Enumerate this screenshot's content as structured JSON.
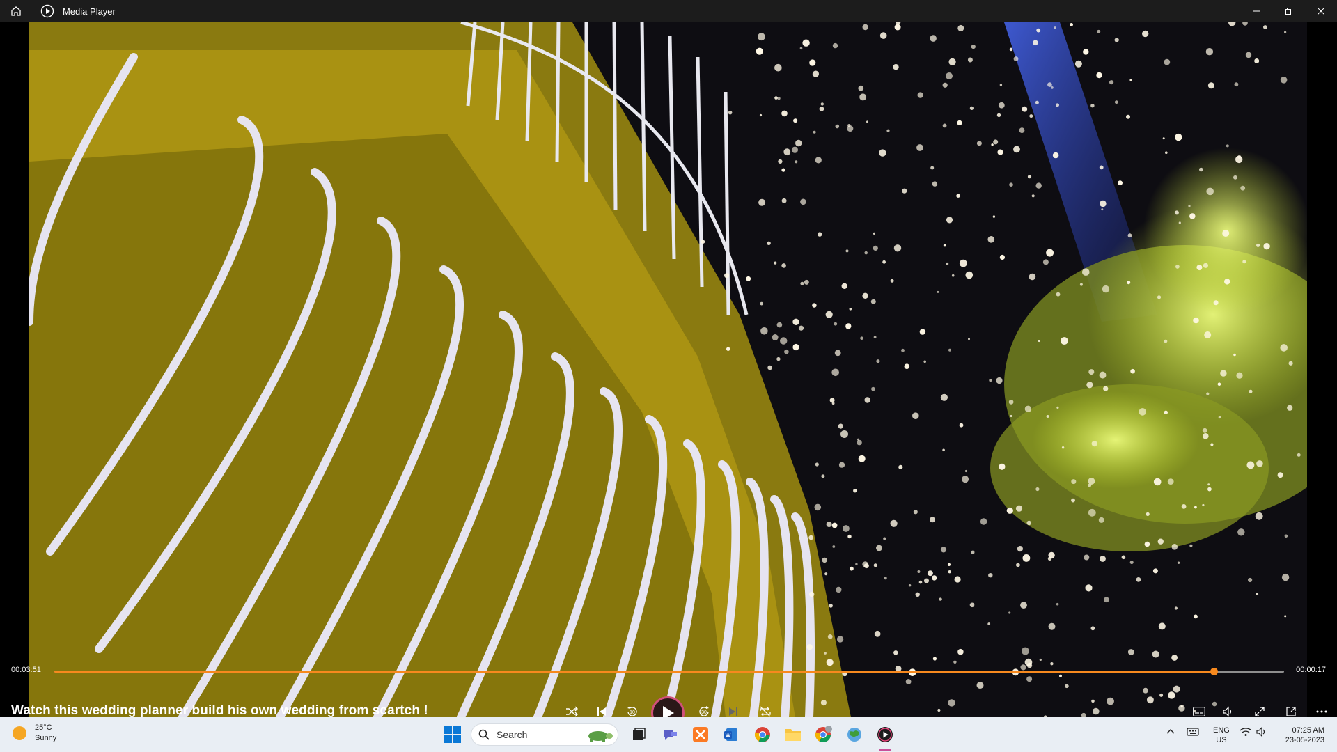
{
  "window": {
    "title": "Media Player"
  },
  "player": {
    "elapsed": "00:03:51",
    "remaining": "00:00:17",
    "progress_fraction": 0.943,
    "video_title": "Watch this wedding planner build his own wedding from scartch !",
    "accent_color": "#f7891e"
  },
  "taskbar": {
    "weather_temp": "25°C",
    "weather_desc": "Sunny",
    "search_placeholder": "Search",
    "lang_line1": "ENG",
    "lang_line2": "US",
    "time": "07:25 AM",
    "date": "23-05-2023"
  }
}
